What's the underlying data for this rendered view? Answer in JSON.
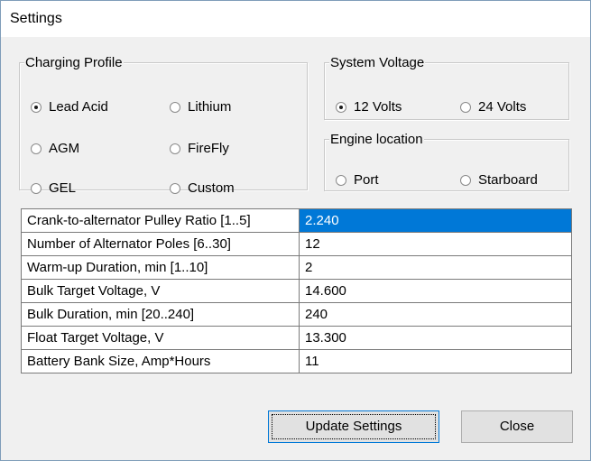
{
  "window": {
    "title": "Settings"
  },
  "charging_profile": {
    "legend": "Charging Profile",
    "options": [
      {
        "label": "Lead Acid",
        "checked": true
      },
      {
        "label": "Lithium",
        "checked": false
      },
      {
        "label": "AGM",
        "checked": false
      },
      {
        "label": "FireFly",
        "checked": false
      },
      {
        "label": "GEL",
        "checked": false
      },
      {
        "label": "Custom",
        "checked": false
      }
    ]
  },
  "system_voltage": {
    "legend": "System Voltage",
    "options": [
      {
        "label": "12 Volts",
        "checked": true
      },
      {
        "label": "24 Volts",
        "checked": false
      }
    ]
  },
  "engine_location": {
    "legend": "Engine location",
    "options": [
      {
        "label": "Port",
        "checked": false
      },
      {
        "label": "Starboard",
        "checked": false
      }
    ]
  },
  "settings_table": {
    "rows": [
      {
        "label": "Crank-to-alternator Pulley Ratio [1..5]",
        "value": "2.240",
        "selected": true
      },
      {
        "label": "Number of Alternator Poles [6..30]",
        "value": "12"
      },
      {
        "label": "Warm-up Duration, min [1..10]",
        "value": "2"
      },
      {
        "label": "Bulk Target Voltage, V",
        "value": "14.600"
      },
      {
        "label": "Bulk Duration, min [20..240]",
        "value": "240"
      },
      {
        "label": "Float Target Voltage, V",
        "value": "13.300"
      },
      {
        "label": "Battery Bank Size, Amp*Hours",
        "value": "11"
      }
    ]
  },
  "buttons": {
    "update": "Update Settings",
    "close": "Close"
  },
  "colors": {
    "selection": "#0078d7",
    "dialog_bg": "#f0f0f0"
  }
}
